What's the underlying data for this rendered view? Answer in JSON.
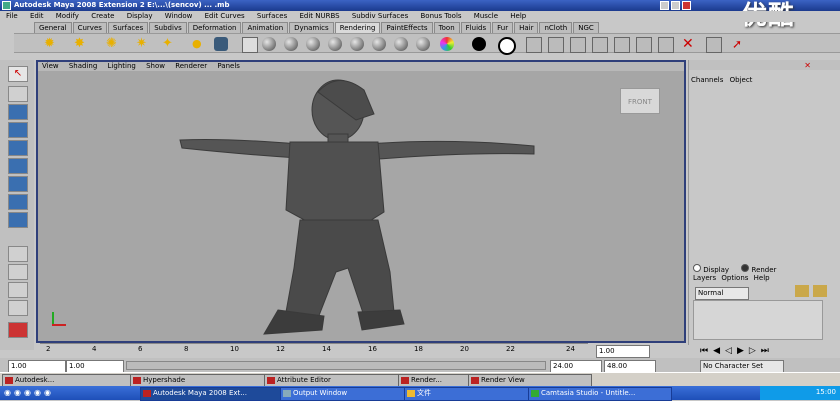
{
  "window": {
    "title": "Autodesk Maya 2008 Extension 2 E:\\...\\(sencov) ... .mb"
  },
  "logo_text": "优酷",
  "menubar": [
    "File",
    "Edit",
    "Modify",
    "Create",
    "Display",
    "Window",
    "Edit Curves",
    "Surfaces",
    "Edit NURBS",
    "Subdiv Surfaces",
    "Bonus Tools",
    "Muscle",
    "Help"
  ],
  "shelf_tabs": [
    "General",
    "Curves",
    "Surfaces",
    "Subdivs",
    "Deformation",
    "Animation",
    "Dynamics",
    "Rendering",
    "PaintEffects",
    "Toon",
    "Fluids",
    "Fur",
    "Hair",
    "nCloth",
    "NGC"
  ],
  "active_shelf_tab": "Rendering",
  "viewport_menu": [
    "View",
    "Shading",
    "Lighting",
    "Show",
    "Renderer",
    "Panels"
  ],
  "view_cube_label": "FRONT",
  "channel_box": {
    "tabs": [
      "Channels",
      "Object"
    ]
  },
  "layers": {
    "display_label": "Display",
    "render_label": "Render",
    "menu": [
      "Layers",
      "Options",
      "Help"
    ],
    "blend_mode": "Normal"
  },
  "timeline": {
    "ticks": [
      "2",
      "4",
      "6",
      "8",
      "10",
      "12",
      "14",
      "16",
      "18",
      "20",
      "22",
      "24"
    ]
  },
  "current_frame": "1.00",
  "range": {
    "start": "1.00",
    "inner_start": "1.00",
    "inner_end": "24.00",
    "end": "48.00",
    "char_set": "No Character Set"
  },
  "taskbar_top": [
    "Autodesk...",
    "Hypershade",
    "Attribute Editor",
    "Render...",
    "Render View"
  ],
  "taskbar_bottom": [
    "Autodesk Maya 2008 Ext...",
    "Output Window",
    "文件",
    "Camtasia Studio - Untitle..."
  ],
  "clock": "15:00",
  "colors": {
    "viewport_bg": "#a6a6a6",
    "title_blue": "#1b3a8e",
    "viewport_border": "#2f3f7a"
  }
}
